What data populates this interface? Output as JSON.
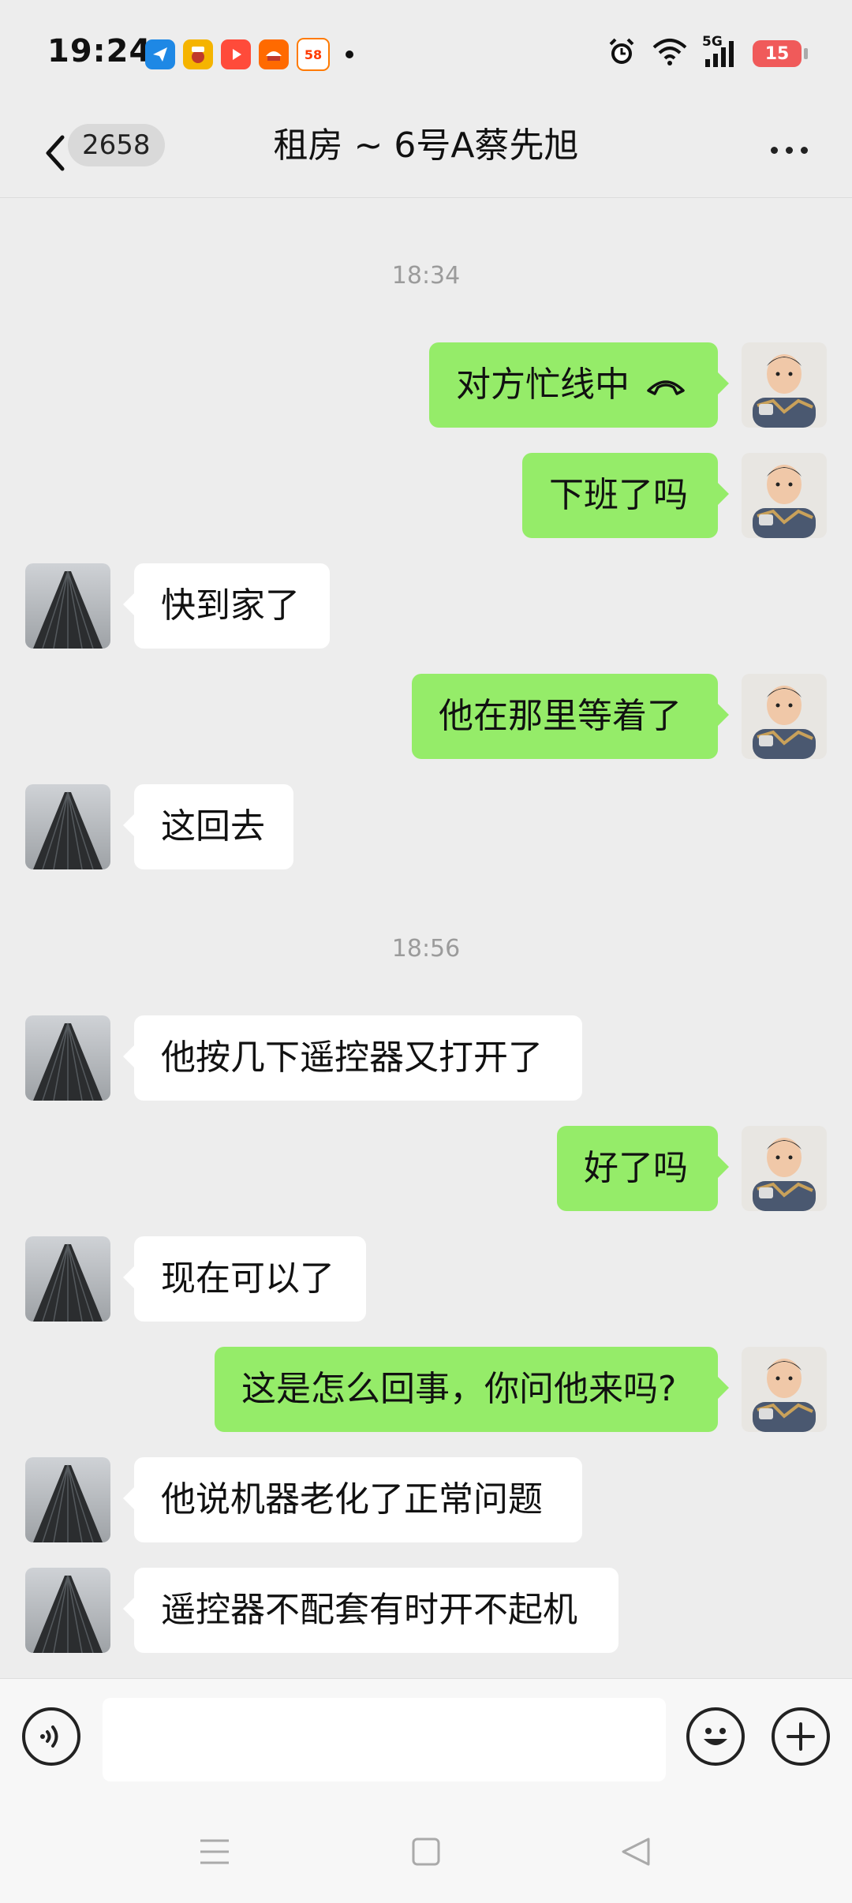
{
  "status_bar": {
    "time": "19:24",
    "battery": "15",
    "network": "5G",
    "app_icons": [
      "feishu-icon",
      "sougou-icon",
      "video-app-icon",
      "taobao-icon",
      "58-app-icon"
    ]
  },
  "header": {
    "unread_count": "2658",
    "title": "租房 ~ 6号A蔡先旭"
  },
  "colors": {
    "sent_bubble": "#95EC69",
    "received_bubble": "#FFFFFF",
    "background": "#EDEDED",
    "battery_low": "#F05A5A"
  },
  "timestamps": [
    "18:34",
    "18:56"
  ],
  "messages": [
    {
      "side": "right",
      "text": "对方忙线中",
      "icon": "hangup-icon"
    },
    {
      "side": "right",
      "text": "下班了吗"
    },
    {
      "side": "left",
      "text": "快到家了"
    },
    {
      "side": "right",
      "text": "他在那里等着了"
    },
    {
      "side": "left",
      "text": "这回去"
    },
    {
      "side": "left",
      "text": "他按几下遥控器又打开了"
    },
    {
      "side": "right",
      "text": "好了吗"
    },
    {
      "side": "left",
      "text": "现在可以了"
    },
    {
      "side": "right",
      "text": "这是怎么回事，你问他来吗?"
    },
    {
      "side": "left",
      "text": "他说机器老化了正常问题"
    },
    {
      "side": "left",
      "text": "遥控器不配套有时开不起机"
    }
  ],
  "input": {
    "value": "",
    "placeholder": ""
  }
}
